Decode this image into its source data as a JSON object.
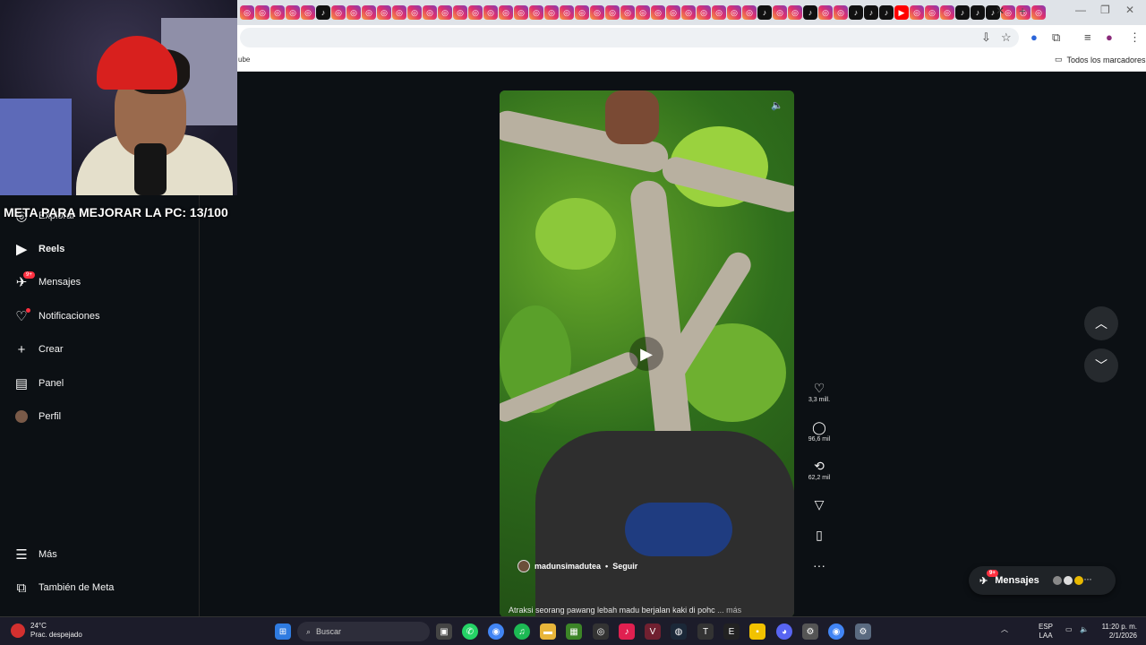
{
  "browser": {
    "tab_icons": [
      "ig",
      "ig",
      "ig",
      "ig",
      "ig",
      "tt",
      "ig",
      "ig",
      "ig",
      "ig",
      "ig",
      "ig",
      "ig",
      "ig",
      "ig",
      "ig",
      "ig",
      "ig",
      "ig",
      "ig",
      "ig",
      "ig",
      "ig",
      "ig",
      "ig",
      "ig",
      "ig",
      "ig",
      "ig",
      "ig",
      "ig",
      "ig",
      "ig",
      "ig",
      "tt",
      "ig",
      "ig",
      "tt",
      "ig",
      "ig",
      "tt",
      "tt",
      "tt",
      "yt",
      "ig",
      "ig",
      "ig",
      "tt",
      "tt",
      "tt",
      "ig",
      "ig",
      "ig"
    ],
    "bookmark_left": "ube",
    "bookmark_right": "Todos los marcadores"
  },
  "overlay": {
    "goal_text": "META PARA MEJORAR LA PC: 13/100"
  },
  "sidebar": {
    "items": [
      {
        "label": "Explorar",
        "icon": "compass-icon"
      },
      {
        "label": "Reels",
        "icon": "reels-icon"
      },
      {
        "label": "Mensajes",
        "icon": "messenger-icon",
        "badge": "9+"
      },
      {
        "label": "Notificaciones",
        "icon": "heart-icon"
      },
      {
        "label": "Crear",
        "icon": "plus-icon"
      },
      {
        "label": "Panel",
        "icon": "dashboard-icon"
      },
      {
        "label": "Perfil",
        "icon": "avatar"
      }
    ],
    "more_label": "Más",
    "meta_label": "También de Meta"
  },
  "reel": {
    "username": "madunsimadutea",
    "follow_label": "Seguir",
    "caption": "Atraksi seorang pawang lebah madu berjalan kaki di pohc",
    "more_label": "... más"
  },
  "actions": {
    "likes": "3,3 mill.",
    "comments": "96,6 mil",
    "reposts": "62,2 mil"
  },
  "messages_pill": {
    "label": "Mensajes",
    "badge": "9+"
  },
  "taskbar": {
    "temp": "24°C",
    "weather": "Prac. despejado",
    "search_placeholder": "Buscar",
    "lang_top": "ESP",
    "lang_bottom": "LAA",
    "time": "11:20 p. m.",
    "date": "2/1/2026"
  },
  "colors": {
    "ig_bg": "#0c1014",
    "notif_red": "#ff3040",
    "taskbar_bg": "#1c1c2a"
  }
}
